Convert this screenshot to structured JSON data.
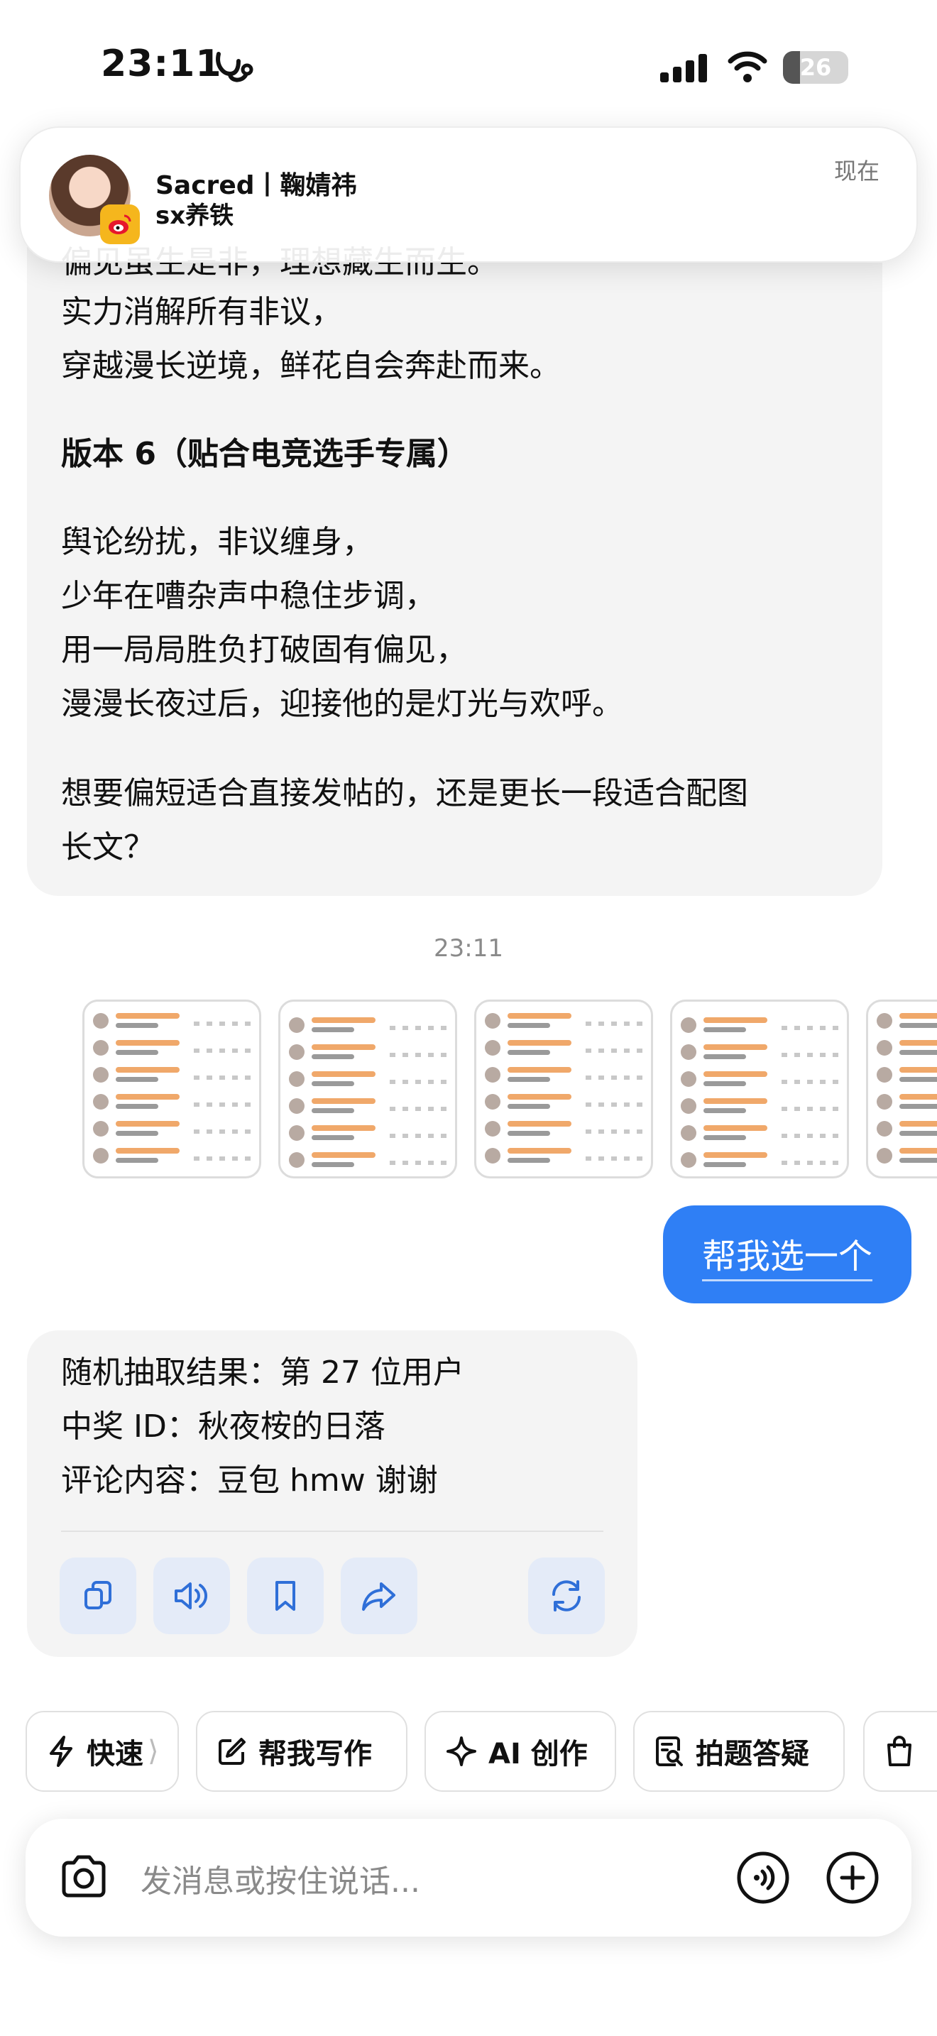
{
  "status_bar": {
    "time": "23:11",
    "battery_level": "26",
    "battery_fraction": 0.26,
    "icons": [
      "stethoscope-icon",
      "signal-icon",
      "wifi-icon",
      "battery-icon"
    ]
  },
  "notification": {
    "title": "Sacred丨鞠婧祎",
    "body": "sx养铁",
    "time": "现在",
    "app_icon": "weibo-icon"
  },
  "assistant_message_1": {
    "lines": [
      "偏见虽生是非，理想藏生而生。",
      "实力消解所有非议，",
      "穿越漫长逆境，鲜花自会奔赴而来。"
    ],
    "heading": "版本 6（贴合电竞选手专属）",
    "poem": [
      "舆论纷扰，非议缠身，",
      "少年在嘈杂声中稳住步调，",
      "用一局局胜负打破固有偏见，",
      "漫漫长夜过后，迎接他的是灯光与欢呼。"
    ],
    "question": [
      "想要偏短适合直接发帖的，还是更长一段适合配图",
      "长文？"
    ]
  },
  "timestamp": "23:11",
  "attachments": {
    "count": 5
  },
  "user_message": {
    "text": "帮我选一个"
  },
  "result_message": {
    "lines": [
      "随机抽取结果：第 27 位用户",
      "中奖 ID：秋夜桉的日落",
      "评论内容：豆包 hmw 谢谢"
    ],
    "actions": [
      "copy-icon",
      "speaker-icon",
      "bookmark-icon",
      "share-icon",
      "regenerate-icon"
    ]
  },
  "quick_actions": [
    {
      "label": "快速",
      "icon": "lightning-icon"
    },
    {
      "label": "帮我写作",
      "icon": "edit-icon"
    },
    {
      "label": "AI 创作",
      "icon": "sparkle-icon"
    },
    {
      "label": "拍题答疑",
      "icon": "scan-question-icon"
    },
    {
      "label": "",
      "icon": "shopping-bag-icon"
    }
  ],
  "input": {
    "placeholder": "发消息或按住说话..."
  },
  "colors": {
    "accent": "#2f7ff5",
    "bubble_bg": "#f4f4f4",
    "action_bg": "#e4ebf8",
    "action_icon": "#2f6fd8"
  }
}
